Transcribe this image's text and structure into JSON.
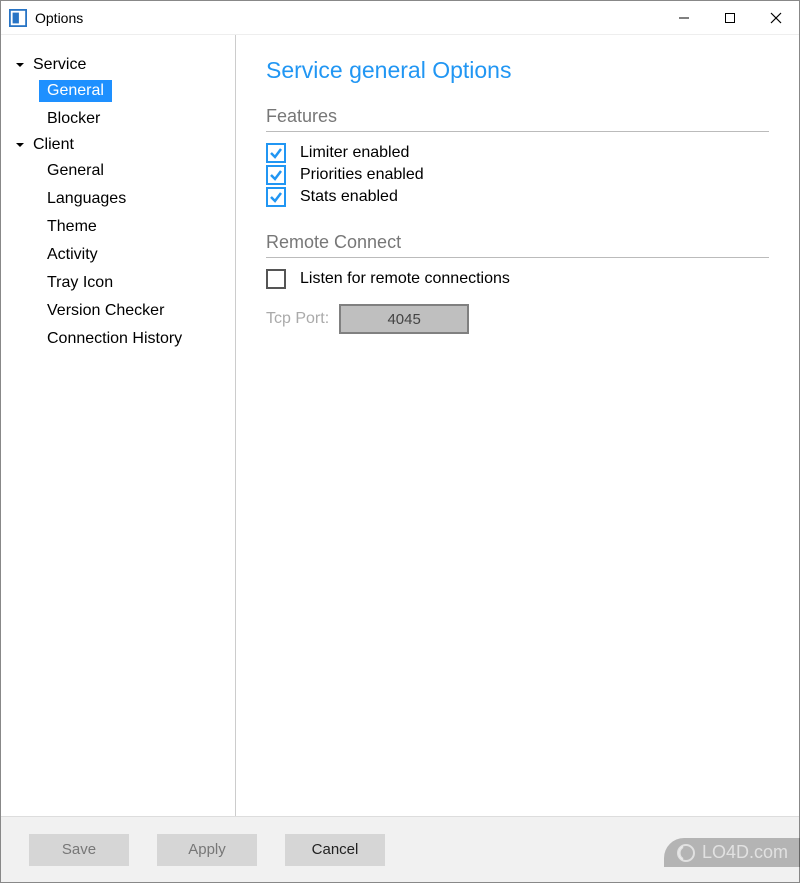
{
  "window": {
    "title": "Options"
  },
  "sidebar": {
    "groups": [
      {
        "label": "Service",
        "expanded": true,
        "children": [
          {
            "label": "General",
            "selected": true
          },
          {
            "label": "Blocker",
            "selected": false
          }
        ]
      },
      {
        "label": "Client",
        "expanded": true,
        "children": [
          {
            "label": "General",
            "selected": false
          },
          {
            "label": "Languages",
            "selected": false
          },
          {
            "label": "Theme",
            "selected": false
          },
          {
            "label": "Activity",
            "selected": false
          },
          {
            "label": "Tray Icon",
            "selected": false
          },
          {
            "label": "Version Checker",
            "selected": false
          },
          {
            "label": "Connection History",
            "selected": false
          }
        ]
      }
    ]
  },
  "page": {
    "title": "Service general Options",
    "sections": {
      "features": {
        "title": "Features",
        "items": [
          {
            "label": "Limiter enabled",
            "checked": true
          },
          {
            "label": "Priorities enabled",
            "checked": true
          },
          {
            "label": "Stats enabled",
            "checked": true
          }
        ]
      },
      "remote": {
        "title": "Remote Connect",
        "listen": {
          "label": "Listen for remote connections",
          "checked": false
        },
        "port": {
          "label": "Tcp Port:",
          "value": "4045",
          "enabled": false
        }
      }
    }
  },
  "buttons": {
    "save": "Save",
    "apply": "Apply",
    "cancel": "Cancel"
  },
  "watermark": "LO4D.com"
}
